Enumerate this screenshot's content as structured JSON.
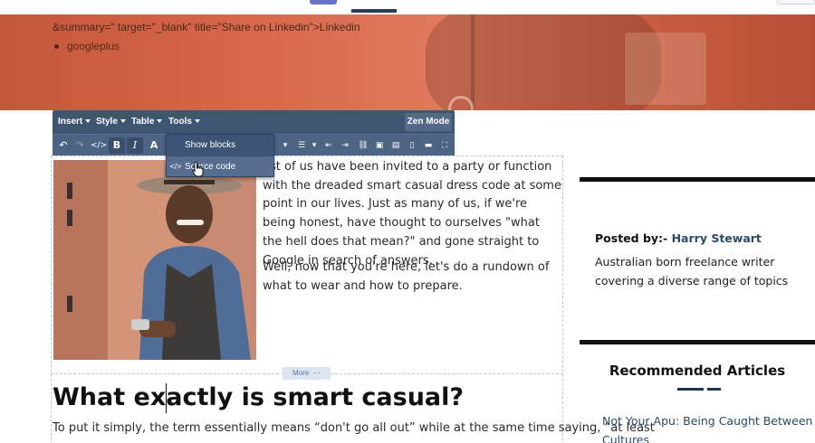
{
  "hero": {
    "html_fragment": "&summary=\" target=\"_blank\" title=\"Share on Linkedin\">Linkedin",
    "list_item": "googleplus"
  },
  "toolbar": {
    "menus": [
      "Insert",
      "Style",
      "Table",
      "Tools"
    ],
    "zen_mode": "Zen Mode",
    "bold": "B",
    "italic": "I",
    "font_color": "A"
  },
  "tools_menu": {
    "items": [
      {
        "label": "Show blocks",
        "icon": ""
      },
      {
        "label": "Source code",
        "icon": "</>"
      }
    ]
  },
  "editor": {
    "para1": "est of us have been invited to a party or function with the dreaded smart casual dress code at some point in our lives. Just as many of us, if we're being honest, have thought to ourselves \"what the hell does that mean?\" and gone straight to Google in search of answers.",
    "para2": "Well, now that you're here, let's do a rundown of what to wear and how to prepare.",
    "more_label": "More",
    "heading": "What exactly is smart casual?",
    "para3": "To put it simply, the term essentially means “don't go all out” while at the same time saying, “at least"
  },
  "sidebar": {
    "posted_by_label": "Posted by:-",
    "author": "Harry Stewart",
    "bio": "Australian born freelance writer covering a diverse range of topics",
    "recommended_title": "Recommended Articles",
    "recommended_links": [
      "Not Your Apu: Being Caught Between Cultures"
    ]
  },
  "colors": {
    "toolbar_bg": "#3f5673",
    "hero_accent": "#d8664a",
    "link": "#2a4a6a"
  }
}
